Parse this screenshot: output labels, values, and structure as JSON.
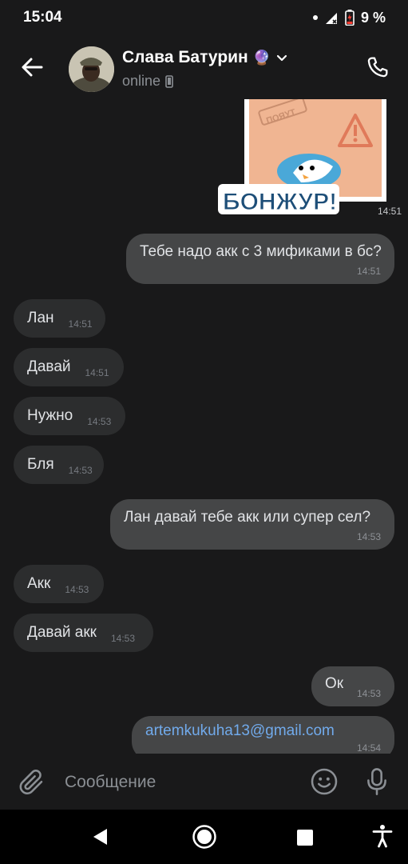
{
  "status": {
    "time": "15:04",
    "battery": "9 %",
    "icons": [
      "notification-dot-icon",
      "signal-icon",
      "battery-icon"
    ]
  },
  "header": {
    "name": "Слава Батурин",
    "name_emoji": "🔮",
    "status": "online",
    "icons": [
      "back-arrow-icon",
      "chevron-down-icon",
      "phone-device-icon",
      "phone-call-icon"
    ]
  },
  "sticker": {
    "text": "БОНЖУР!",
    "sign_text": "ПОЯУТ",
    "time": "14:51"
  },
  "messages": [
    {
      "dir": "out",
      "text": "Тебе надо акк с 3 мификами в бс?",
      "time": "14:51"
    },
    {
      "dir": "in",
      "text": "Лан",
      "time": "14:51"
    },
    {
      "dir": "in",
      "text": "Давай",
      "time": "14:51"
    },
    {
      "dir": "in",
      "text": "Нужно",
      "time": "14:53"
    },
    {
      "dir": "in",
      "text": "Бля",
      "time": "14:53"
    },
    {
      "dir": "out",
      "text": "Лан давай тебе акк или супер сел?",
      "time": "14:53"
    },
    {
      "dir": "in",
      "text": "Акк",
      "time": "14:53"
    },
    {
      "dir": "in",
      "text": "Давай акк",
      "time": "14:53"
    },
    {
      "dir": "out",
      "text": "Ок",
      "time": "14:53"
    },
    {
      "dir": "out",
      "text": "artemkukuha13@gmail.com",
      "time": "14:54",
      "link": true
    }
  ],
  "composer": {
    "placeholder": "Сообщение",
    "icons": [
      "paperclip-icon",
      "emoji-icon",
      "microphone-icon"
    ]
  },
  "navbar": {
    "icons": [
      "nav-back-icon",
      "nav-home-icon",
      "nav-recents-icon",
      "accessibility-icon"
    ]
  },
  "colors": {
    "background": "#19191a",
    "incoming_bubble": "#2c2d2e",
    "outgoing_bubble": "#454647",
    "link": "#71aaeb",
    "meta_text": "#8b8f94"
  }
}
